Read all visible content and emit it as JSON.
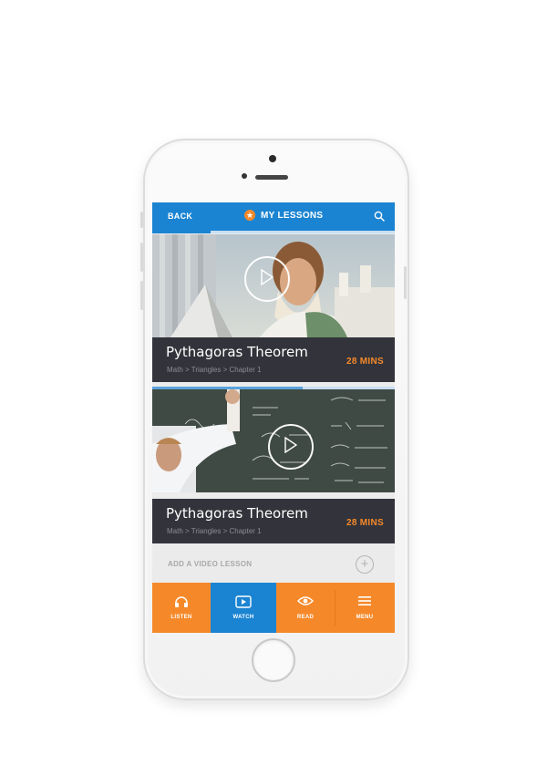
{
  "header": {
    "back_label": "BACK",
    "title": "MY LESSONS",
    "title_icon": "star-icon",
    "search_icon": "search-icon",
    "progress": 0.24
  },
  "lessons": [
    {
      "title": "Pythagoras Theorem",
      "breadcrumb": "Math  >  Triangles  >  Chapter 1",
      "duration": "28 MINS",
      "progress": 0.0
    },
    {
      "title": "Pythagoras Theorem",
      "breadcrumb": "Math  >  Triangles  >  Chapter 1",
      "duration": "28 MINS",
      "progress": 0.62
    }
  ],
  "add_lesson": {
    "label": "ADD A VIDEO LESSON",
    "icon": "plus-circle-icon"
  },
  "tabs": [
    {
      "label": "LISTEN",
      "icon": "headphones-icon",
      "active": false
    },
    {
      "label": "WATCH",
      "icon": "play-video-icon",
      "active": true
    },
    {
      "label": "READ",
      "icon": "eye-icon",
      "active": false
    },
    {
      "label": "MENU",
      "icon": "hamburger-icon",
      "active": false
    }
  ],
  "colors": {
    "primary_blue": "#1b84d2",
    "accent_orange": "#f5892a",
    "card_dark": "#33343b"
  }
}
